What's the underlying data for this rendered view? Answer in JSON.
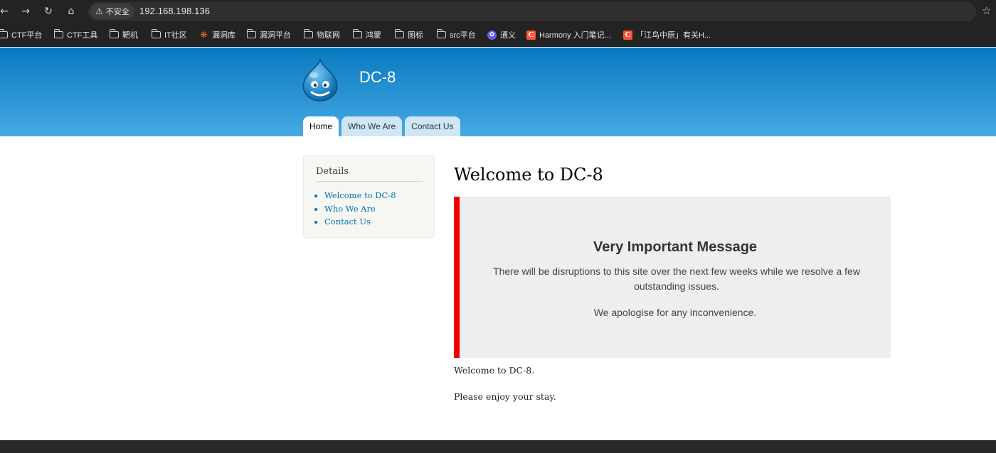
{
  "browser": {
    "back_icon": "←",
    "forward_icon": "→",
    "reload_icon": "↻",
    "home_icon": "⌂",
    "security_warning_icon": "⚠",
    "security_label": "不安全",
    "url": "192.168.198.136",
    "bookmark_star_icon": "☆",
    "bookmarks": [
      {
        "label": "CTF平台",
        "icon": "folder-icon"
      },
      {
        "label": "CTF工具",
        "icon": "folder-icon"
      },
      {
        "label": "靶机",
        "icon": "folder-icon"
      },
      {
        "label": "IT社区",
        "icon": "folder-icon"
      },
      {
        "label": "漏洞库",
        "icon": "bug-icon"
      },
      {
        "label": "漏洞平台",
        "icon": "folder-icon"
      },
      {
        "label": "物联网",
        "icon": "folder-icon"
      },
      {
        "label": "鸿蒙",
        "icon": "folder-icon"
      },
      {
        "label": "图标",
        "icon": "folder-icon"
      },
      {
        "label": "src平台",
        "icon": "folder-icon"
      },
      {
        "label": "通义",
        "icon": "tongyi-icon"
      },
      {
        "label": "Harmony 入门笔记...",
        "icon": "csdn-icon"
      },
      {
        "label": "「江鸟中原」有关H...",
        "icon": "csdn-icon"
      }
    ],
    "bookmark_glyphs": {
      "bug": "❋",
      "tongyi": "✿",
      "csdn": "C"
    }
  },
  "site": {
    "name": "DC-8",
    "menu": [
      {
        "label": "Home",
        "active": true
      },
      {
        "label": "Who We Are",
        "active": false
      },
      {
        "label": "Contact Us",
        "active": false
      }
    ]
  },
  "sidebar": {
    "title": "Details",
    "links": [
      "Welcome to DC-8",
      "Who We Are",
      "Contact Us"
    ]
  },
  "content": {
    "title": "Welcome to DC-8",
    "message_heading": "Very Important Message",
    "message_body": "There will be disruptions to this site over the next few weeks while we resolve a few outstanding issues.",
    "message_apology": "We apologise for any inconvenience.",
    "paragraph1": "Welcome to DC-8.",
    "paragraph2": "Please enjoy your stay."
  },
  "colors": {
    "header_top": "#0779bf",
    "header_bottom": "#48a9e4",
    "link": "#0071b3",
    "alert_border": "#ee0000",
    "message_bg": "#eeeeee"
  }
}
